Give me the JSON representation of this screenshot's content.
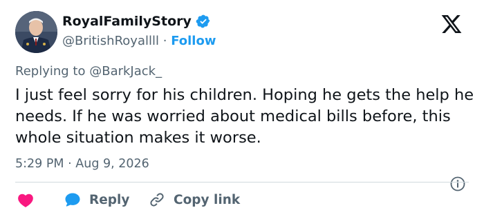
{
  "author": {
    "display_name": "RoyalFamilyStory",
    "handle": "@BritishRoyallll",
    "separator": "·",
    "follow_label": "Follow",
    "verified": true
  },
  "reply_context": {
    "prefix": "Replying to",
    "handle": "@BarkJack_"
  },
  "tweet": {
    "text": "I just feel sorry for his children. Hoping he gets the help he needs. If he was worried about medical bills before, this whole situation makes it worse.",
    "time": "5:29 PM",
    "separator": "·",
    "date": "Aug 9, 2026"
  },
  "actions": {
    "like_icon": "heart-icon",
    "reply_label": "Reply",
    "copy_link_label": "Copy link"
  },
  "colors": {
    "brand_blue": "#1d9bf0",
    "like_red": "#f91880",
    "text_primary": "#0f1419",
    "text_secondary": "#536471",
    "divider": "#cfd9de"
  }
}
